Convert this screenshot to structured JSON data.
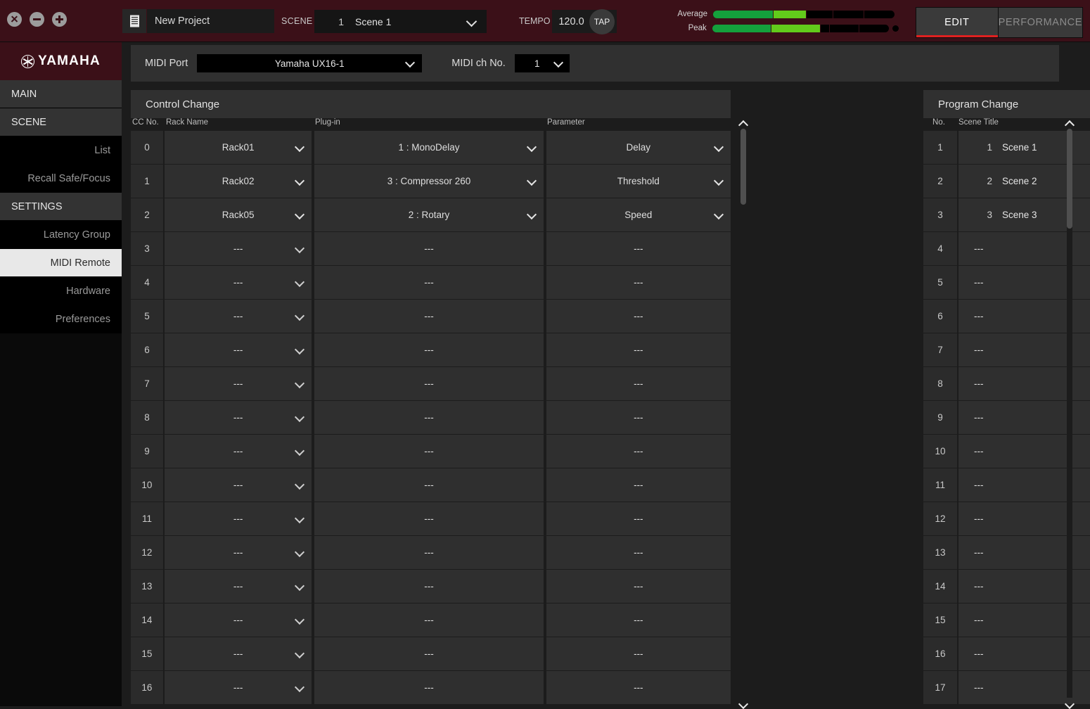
{
  "window": {
    "close_label": "close-window",
    "minimize_label": "minimize-window",
    "maximize_label": "maximize-window"
  },
  "header": {
    "project_name": "New Project",
    "scene_label": "SCENE",
    "scene_number": "1",
    "scene_name": "Scene 1",
    "tempo_label": "TEMPO",
    "tempo_value": "120.0",
    "tap_label": "TAP",
    "meters": [
      {
        "label": "Average",
        "green_pct": 33,
        "bright_pct": 18
      },
      {
        "label": "Peak",
        "green_pct": 33,
        "bright_pct": 28
      }
    ],
    "mode_buttons": [
      {
        "label": "EDIT",
        "active": true
      },
      {
        "label": "PERFORMANCE",
        "active": false
      }
    ]
  },
  "sidebar": {
    "brand": "YAMAHA",
    "items": [
      {
        "label": "MAIN",
        "type": "group",
        "active": false
      },
      {
        "label": "SCENE",
        "type": "group",
        "active": false
      },
      {
        "label": "List",
        "type": "sub",
        "active": false
      },
      {
        "label": "Recall Safe/Focus",
        "type": "sub",
        "active": false
      },
      {
        "label": "SETTINGS",
        "type": "group",
        "active": false
      },
      {
        "label": "Latency Group",
        "type": "sub",
        "active": false
      },
      {
        "label": "MIDI Remote",
        "type": "sub",
        "active": true
      },
      {
        "label": "Hardware",
        "type": "sub",
        "active": false
      },
      {
        "label": "Preferences",
        "type": "sub",
        "active": false
      }
    ]
  },
  "toolbar": {
    "midi_port_label": "MIDI Port",
    "midi_port_value": "Yamaha UX16-1",
    "midi_ch_label": "MIDI ch No.",
    "midi_ch_value": "1"
  },
  "control_change": {
    "title": "Control Change",
    "columns": [
      "CC No.",
      "Rack Name",
      "Plug-in",
      "Parameter"
    ],
    "empty_text": "---",
    "rows": [
      {
        "cc": "0",
        "rack": "Rack01",
        "plugin": "1 : MonoDelay",
        "parameter": "Delay"
      },
      {
        "cc": "1",
        "rack": "Rack02",
        "plugin": "3 : Compressor 260",
        "parameter": "Threshold"
      },
      {
        "cc": "2",
        "rack": "Rack05",
        "plugin": "2 : Rotary",
        "parameter": "Speed"
      },
      {
        "cc": "3",
        "rack": "---",
        "plugin": "---",
        "parameter": "---"
      },
      {
        "cc": "4",
        "rack": "---",
        "plugin": "---",
        "parameter": "---"
      },
      {
        "cc": "5",
        "rack": "---",
        "plugin": "---",
        "parameter": "---"
      },
      {
        "cc": "6",
        "rack": "---",
        "plugin": "---",
        "parameter": "---"
      },
      {
        "cc": "7",
        "rack": "---",
        "plugin": "---",
        "parameter": "---"
      },
      {
        "cc": "8",
        "rack": "---",
        "plugin": "---",
        "parameter": "---"
      },
      {
        "cc": "9",
        "rack": "---",
        "plugin": "---",
        "parameter": "---"
      },
      {
        "cc": "10",
        "rack": "---",
        "plugin": "---",
        "parameter": "---"
      },
      {
        "cc": "11",
        "rack": "---",
        "plugin": "---",
        "parameter": "---"
      },
      {
        "cc": "12",
        "rack": "---",
        "plugin": "---",
        "parameter": "---"
      },
      {
        "cc": "13",
        "rack": "---",
        "plugin": "---",
        "parameter": "---"
      },
      {
        "cc": "14",
        "rack": "---",
        "plugin": "---",
        "parameter": "---"
      },
      {
        "cc": "15",
        "rack": "---",
        "plugin": "---",
        "parameter": "---"
      },
      {
        "cc": "16",
        "rack": "---",
        "plugin": "---",
        "parameter": "---"
      }
    ]
  },
  "program_change": {
    "title": "Program Change",
    "columns": [
      "No.",
      "Scene Title"
    ],
    "empty_text": "---",
    "rows": [
      {
        "no": "1",
        "index": "1",
        "title": "Scene 1",
        "empty": false
      },
      {
        "no": "2",
        "index": "2",
        "title": "Scene 2",
        "empty": false
      },
      {
        "no": "3",
        "index": "3",
        "title": "Scene 3",
        "empty": false
      },
      {
        "no": "4",
        "index": "",
        "title": "---",
        "empty": true
      },
      {
        "no": "5",
        "index": "",
        "title": "---",
        "empty": true
      },
      {
        "no": "6",
        "index": "",
        "title": "---",
        "empty": true
      },
      {
        "no": "7",
        "index": "",
        "title": "---",
        "empty": true
      },
      {
        "no": "8",
        "index": "",
        "title": "---",
        "empty": true
      },
      {
        "no": "9",
        "index": "",
        "title": "---",
        "empty": true
      },
      {
        "no": "10",
        "index": "",
        "title": "---",
        "empty": true
      },
      {
        "no": "11",
        "index": "",
        "title": "---",
        "empty": true
      },
      {
        "no": "12",
        "index": "",
        "title": "---",
        "empty": true
      },
      {
        "no": "13",
        "index": "",
        "title": "---",
        "empty": true
      },
      {
        "no": "14",
        "index": "",
        "title": "---",
        "empty": true
      },
      {
        "no": "15",
        "index": "",
        "title": "---",
        "empty": true
      },
      {
        "no": "16",
        "index": "",
        "title": "---",
        "empty": true
      },
      {
        "no": "17",
        "index": "",
        "title": "---",
        "empty": true
      }
    ]
  },
  "colors": {
    "accent_maroon": "#3b1018",
    "active_red": "#e02020",
    "meter_green": "#14a03c",
    "meter_bright": "#62cb1b",
    "panel": "#303030",
    "cell": "#2f2f2f"
  }
}
